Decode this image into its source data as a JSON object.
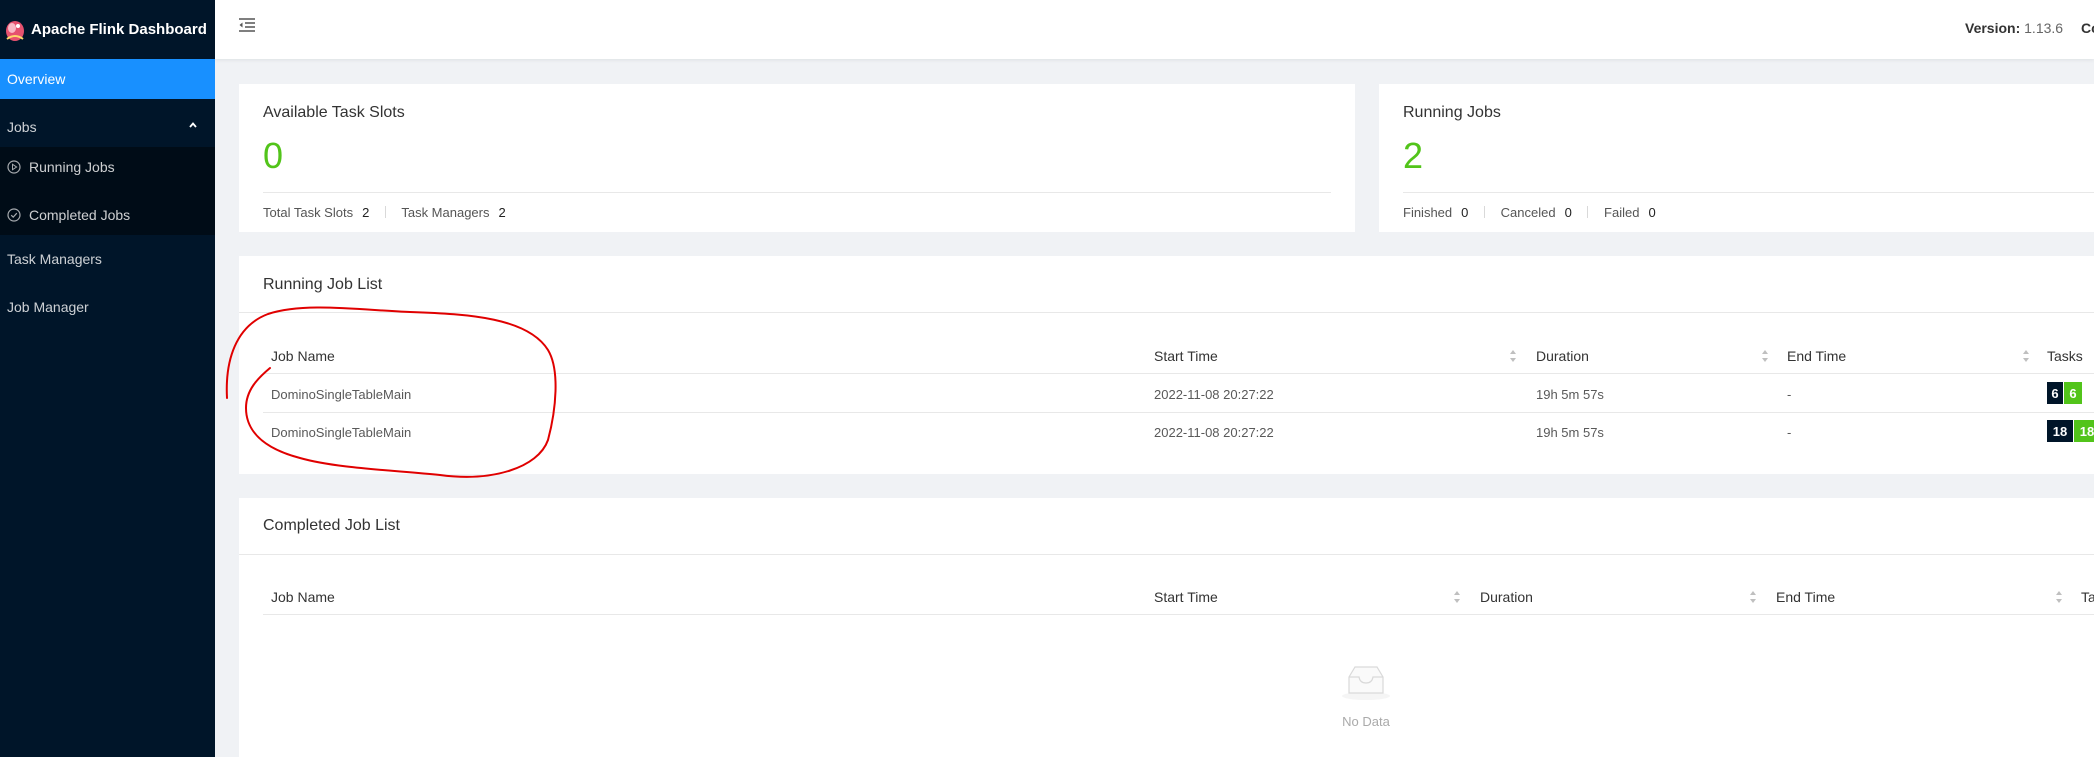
{
  "app": {
    "title": "Apache Flink Dashboard"
  },
  "sidebar": {
    "overview": "Overview",
    "jobs": "Jobs",
    "running_jobs": "Running Jobs",
    "completed_jobs": "Completed Jobs",
    "task_managers": "Task Managers",
    "job_manager": "Job Manager"
  },
  "header": {
    "version_label": "Version:",
    "version_value": "1.13.6",
    "commit_label_partial": "Co"
  },
  "slots_card": {
    "title": "Available Task Slots",
    "value": "0",
    "total_label": "Total Task Slots",
    "total_value": "2",
    "tm_label": "Task Managers",
    "tm_value": "2"
  },
  "jobs_card": {
    "title": "Running Jobs",
    "value": "2",
    "finished_label": "Finished",
    "finished_value": "0",
    "canceled_label": "Canceled",
    "canceled_value": "0",
    "failed_label": "Failed",
    "failed_value": "0"
  },
  "running_list": {
    "title": "Running Job List",
    "columns": [
      "Job Name",
      "Start Time",
      "Duration",
      "End Time",
      "Tasks"
    ],
    "rows": [
      {
        "name": "DominoSingleTableMain",
        "start": "2022-11-08 20:27:22",
        "duration": "19h 5m 57s",
        "end": "-",
        "tasks_total": "6",
        "tasks_running": "6"
      },
      {
        "name": "DominoSingleTableMain",
        "start": "2022-11-08 20:27:22",
        "duration": "19h 5m 57s",
        "end": "-",
        "tasks_total": "18",
        "tasks_running": "18"
      }
    ]
  },
  "completed_list": {
    "title": "Completed Job List",
    "columns": [
      "Job Name",
      "Start Time",
      "Duration",
      "End Time",
      "Ta"
    ],
    "empty_text": "No Data"
  },
  "colors": {
    "sidebar_bg": "#001529",
    "active": "#1890ff",
    "success": "#52c41a",
    "badge_dark": "#001529",
    "annotation": "#e00000"
  }
}
